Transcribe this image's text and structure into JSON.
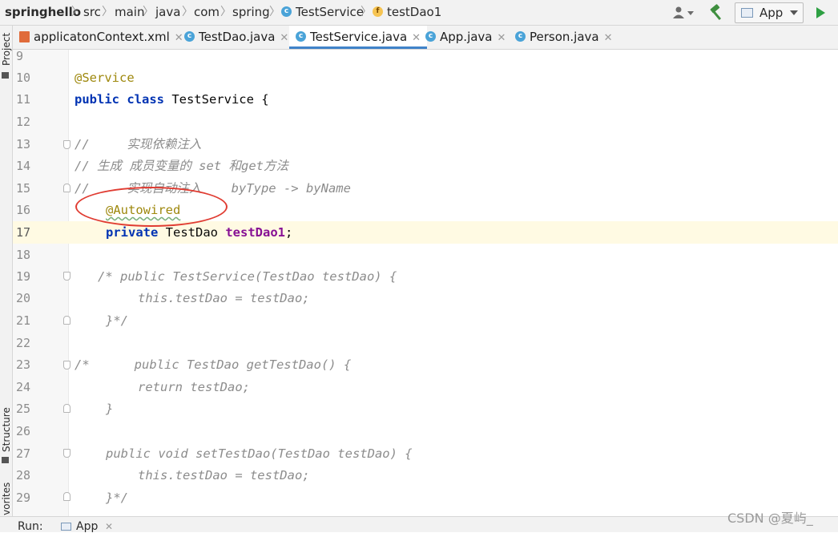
{
  "breadcrumb": {
    "project": "springhello",
    "items": [
      "src",
      "main",
      "java",
      "com",
      "spring",
      "TestService",
      "testDao1"
    ],
    "separator": "〉"
  },
  "toolbar": {
    "run_config": "App"
  },
  "tabs": [
    {
      "label": "applicatonContext.xml",
      "icon": "xml-file-icon",
      "active": false
    },
    {
      "label": "TestDao.java",
      "icon": "class-icon",
      "active": false
    },
    {
      "label": "TestService.java",
      "icon": "class-icon",
      "active": true
    },
    {
      "label": "App.java",
      "icon": "class-run-icon",
      "active": false
    },
    {
      "label": "Person.java",
      "icon": "class-icon",
      "active": false
    }
  ],
  "left_tools": {
    "project": "Project",
    "structure": "Structure",
    "favorites": "Favorites"
  },
  "editor": {
    "current_line": 17,
    "lines": [
      {
        "n": "9"
      },
      {
        "n": "10"
      },
      {
        "n": "11"
      },
      {
        "n": "12"
      },
      {
        "n": "13"
      },
      {
        "n": "14"
      },
      {
        "n": "15"
      },
      {
        "n": "16"
      },
      {
        "n": "17"
      },
      {
        "n": "18"
      },
      {
        "n": "19"
      },
      {
        "n": "20"
      },
      {
        "n": "21"
      },
      {
        "n": "22"
      },
      {
        "n": "23"
      },
      {
        "n": "24"
      },
      {
        "n": "25"
      },
      {
        "n": "26"
      },
      {
        "n": "27"
      },
      {
        "n": "28"
      },
      {
        "n": "29"
      }
    ],
    "code": {
      "l10": "@Service",
      "l11_kw": "public class",
      "l11_rest": " TestService {",
      "l13": "//     实现依赖注入",
      "l14": "// 生成 成员变量的 set 和get方法",
      "l15": "//     实现自动注入    byType -> byName",
      "l16": "@Autowired",
      "l17_kw": "private",
      "l17_type": " TestDao ",
      "l17_field": "testDao1",
      "l17_end": ";",
      "l19": "/* public TestService(TestDao testDao) {",
      "l20": "this.testDao = testDao;",
      "l21": "}*/",
      "l23": "/*      public TestDao getTestDao() {",
      "l24": "return testDao;",
      "l25": "}",
      "l27": "public void setTestDao(TestDao testDao) {",
      "l28": "this.testDao = testDao;",
      "l29": "}*/"
    }
  },
  "bottom": {
    "run_label": "Run:",
    "run_tab": "App"
  },
  "watermark": "CSDN @夏屿_",
  "colors": {
    "keyword": "#0033b3",
    "annotation": "#9e880d",
    "comment": "#8c8c8c",
    "field": "#871094",
    "highlight_circle": "#e03c32",
    "active_tab_underline": "#4083c9"
  }
}
